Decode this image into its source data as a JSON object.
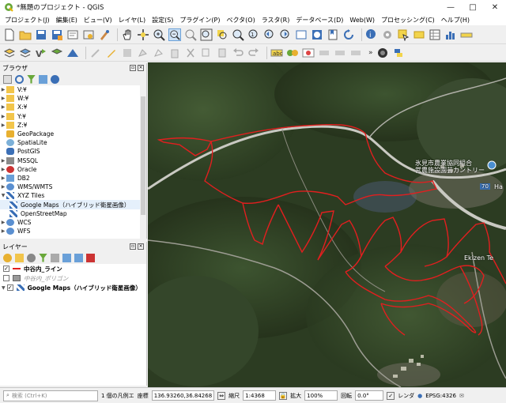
{
  "window": {
    "title": "*無題のプロジェクト - QGIS"
  },
  "menu": [
    "プロジェクト(J)",
    "編集(E)",
    "ビュー(V)",
    "レイヤ(L)",
    "設定(S)",
    "プラグイン(P)",
    "ベクタ(O)",
    "ラスタ(R)",
    "データベース(D)",
    "Web(W)",
    "プロセッシング(C)",
    "ヘルプ(H)"
  ],
  "browser": {
    "title": "ブラウザ",
    "items": [
      {
        "label": "V:¥",
        "expanded": false
      },
      {
        "label": "W:¥",
        "expanded": false
      },
      {
        "label": "X:¥",
        "expanded": false
      },
      {
        "label": "Y:¥",
        "expanded": false
      },
      {
        "label": "Z:¥",
        "expanded": false
      },
      {
        "label": "GeoPackage",
        "expanded": null
      },
      {
        "label": "SpatiaLite",
        "expanded": null
      },
      {
        "label": "PostGIS",
        "expanded": null
      },
      {
        "label": "MSSQL",
        "expanded": false
      },
      {
        "label": "Oracle",
        "expanded": false
      },
      {
        "label": "DB2",
        "expanded": false
      },
      {
        "label": "WMS/WMTS",
        "expanded": false
      },
      {
        "label": "XYZ Tiles",
        "expanded": true
      },
      {
        "label": "Google Maps（ハイブリッド衛星画像）",
        "child": true,
        "selected": true
      },
      {
        "label": "OpenStreetMap",
        "child": true
      },
      {
        "label": "WCS",
        "expanded": false
      },
      {
        "label": "WFS",
        "expanded": false
      }
    ]
  },
  "layers": {
    "title": "レイヤー",
    "items": [
      {
        "label": "中谷内_ライン",
        "checked": true,
        "bold": true
      },
      {
        "label": "中谷内_ポリゴン",
        "checked": false,
        "bold": false
      },
      {
        "label": "Google Maps（ハイブリッド衛星画像）",
        "checked": true,
        "bold": true
      }
    ]
  },
  "map": {
    "labels": [
      "氷見市農業協同組合",
      "営農施設園芸カントリー",
      "Ekizen Te",
      "70",
      "Ha"
    ],
    "colors": {
      "boundary": "#e21f1f",
      "forest": "#2c3c22",
      "road": "#c9c9c2",
      "water": "#3c4b4c"
    }
  },
  "status": {
    "search_placeholder": "検索 (Ctrl+K)",
    "legend_msg": "1 個の凡例エ",
    "coord_label": "座標",
    "coord_value": "136.93260,36.84268",
    "scale_label": "縮尺",
    "scale_value": "1:4368",
    "zoom_label": "拡大",
    "zoom_value": "100%",
    "rotation_label": "回転",
    "rotation_value": "0.0°",
    "render_label": "レンダ",
    "crs": "EPSG:4326"
  }
}
